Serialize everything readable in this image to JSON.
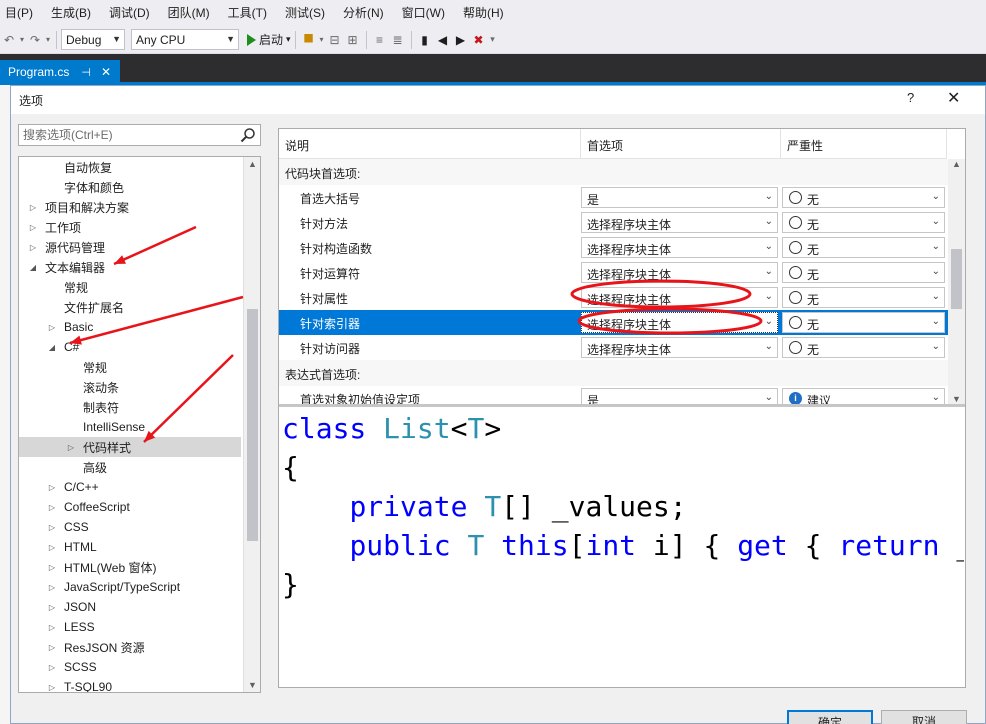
{
  "menu": [
    "目(P)",
    "生成(B)",
    "调试(D)",
    "团队(M)",
    "工具(T)",
    "测试(S)",
    "分析(N)",
    "窗口(W)",
    "帮助(H)"
  ],
  "toolbar": {
    "config": "Debug",
    "platform": "Any CPU",
    "start_label": "启动"
  },
  "doc_tab": {
    "label": "Program.cs",
    "pin": "⊣",
    "close": "✕"
  },
  "dialog": {
    "title": "选项",
    "help": "?",
    "close": "✕",
    "search_placeholder": "搜索选项(Ctrl+E)",
    "ok": "确定",
    "cancel": "取消"
  },
  "tree": [
    {
      "label": "自动恢复",
      "level": 2,
      "exp": ""
    },
    {
      "label": "字体和颜色",
      "level": 2,
      "exp": ""
    },
    {
      "label": "项目和解决方案",
      "level": 1,
      "exp": "▷"
    },
    {
      "label": "工作项",
      "level": 1,
      "exp": "▷"
    },
    {
      "label": "源代码管理",
      "level": 1,
      "exp": "▷"
    },
    {
      "label": "文本编辑器",
      "level": 1,
      "exp": "◢"
    },
    {
      "label": "常规",
      "level": 2,
      "exp": ""
    },
    {
      "label": "文件扩展名",
      "level": 2,
      "exp": ""
    },
    {
      "label": "Basic",
      "level": 2,
      "exp": "▷"
    },
    {
      "label": "C#",
      "level": 2,
      "exp": "◢"
    },
    {
      "label": "常规",
      "level": 3,
      "exp": ""
    },
    {
      "label": "滚动条",
      "level": 3,
      "exp": ""
    },
    {
      "label": "制表符",
      "level": 3,
      "exp": ""
    },
    {
      "label": "IntelliSense",
      "level": 3,
      "exp": ""
    },
    {
      "label": "代码样式",
      "level": 3,
      "exp": "▷",
      "selected": true
    },
    {
      "label": "高级",
      "level": 3,
      "exp": ""
    },
    {
      "label": "C/C++",
      "level": 2,
      "exp": "▷"
    },
    {
      "label": "CoffeeScript",
      "level": 2,
      "exp": "▷"
    },
    {
      "label": "CSS",
      "level": 2,
      "exp": "▷"
    },
    {
      "label": "HTML",
      "level": 2,
      "exp": "▷"
    },
    {
      "label": "HTML(Web 窗体)",
      "level": 2,
      "exp": "▷"
    },
    {
      "label": "JavaScript/TypeScript",
      "level": 2,
      "exp": "▷"
    },
    {
      "label": "JSON",
      "level": 2,
      "exp": "▷"
    },
    {
      "label": "LESS",
      "level": 2,
      "exp": "▷"
    },
    {
      "label": "ResJSON 资源",
      "level": 2,
      "exp": "▷"
    },
    {
      "label": "SCSS",
      "level": 2,
      "exp": "▷"
    },
    {
      "label": "T-SQL90",
      "level": 2,
      "exp": "▷"
    }
  ],
  "grid": {
    "headers": [
      "说明",
      "首选项",
      "严重性"
    ],
    "rows": [
      {
        "type": "group",
        "label": "代码块首选项:"
      },
      {
        "type": "option",
        "label": "首选大括号",
        "pref": "是",
        "sev": "无",
        "sev_icon": "radio"
      },
      {
        "type": "option",
        "label": "针对方法",
        "pref": "选择程序块主体",
        "sev": "无",
        "sev_icon": "radio"
      },
      {
        "type": "option",
        "label": "针对构造函数",
        "pref": "选择程序块主体",
        "sev": "无",
        "sev_icon": "radio"
      },
      {
        "type": "option",
        "label": "针对运算符",
        "pref": "选择程序块主体",
        "sev": "无",
        "sev_icon": "radio"
      },
      {
        "type": "option",
        "label": "针对属性",
        "pref": "选择程序块主体",
        "sev": "无",
        "sev_icon": "radio"
      },
      {
        "type": "option",
        "label": "针对索引器",
        "pref": "选择程序块主体",
        "sev": "无",
        "sev_icon": "radio",
        "selected": true
      },
      {
        "type": "option",
        "label": "针对访问器",
        "pref": "选择程序块主体",
        "sev": "无",
        "sev_icon": "radio"
      },
      {
        "type": "group",
        "label": "表达式首选项:"
      },
      {
        "type": "option",
        "label": "首选对象初始值设定项",
        "pref": "是",
        "sev": "建议",
        "sev_icon": "info"
      }
    ]
  },
  "code_preview": [
    [
      {
        "t": "class",
        "c": "kw"
      },
      {
        "t": " ",
        "c": "tx"
      },
      {
        "t": "List",
        "c": "ty"
      },
      {
        "t": "<",
        "c": "tx"
      },
      {
        "t": "T",
        "c": "ty"
      },
      {
        "t": ">",
        "c": "tx"
      }
    ],
    [
      {
        "t": "{",
        "c": "tx"
      }
    ],
    [
      {
        "t": "    ",
        "c": "tx"
      },
      {
        "t": "private",
        "c": "kw"
      },
      {
        "t": " ",
        "c": "tx"
      },
      {
        "t": "T",
        "c": "ty"
      },
      {
        "t": "[] _values;",
        "c": "tx"
      }
    ],
    [
      {
        "t": "    ",
        "c": "tx"
      },
      {
        "t": "public",
        "c": "kw"
      },
      {
        "t": " ",
        "c": "tx"
      },
      {
        "t": "T",
        "c": "ty"
      },
      {
        "t": " ",
        "c": "tx"
      },
      {
        "t": "this",
        "c": "kw"
      },
      {
        "t": "[",
        "c": "tx"
      },
      {
        "t": "int",
        "c": "kw"
      },
      {
        "t": " i] { ",
        "c": "tx"
      },
      {
        "t": "get",
        "c": "kw"
      },
      {
        "t": " { ",
        "c": "tx"
      },
      {
        "t": "return",
        "c": "kw"
      },
      {
        "t": " _values[i]; } }",
        "c": "tx"
      }
    ],
    [
      {
        "t": "}",
        "c": "tx"
      }
    ]
  ],
  "annotation_color": "#e8141a"
}
